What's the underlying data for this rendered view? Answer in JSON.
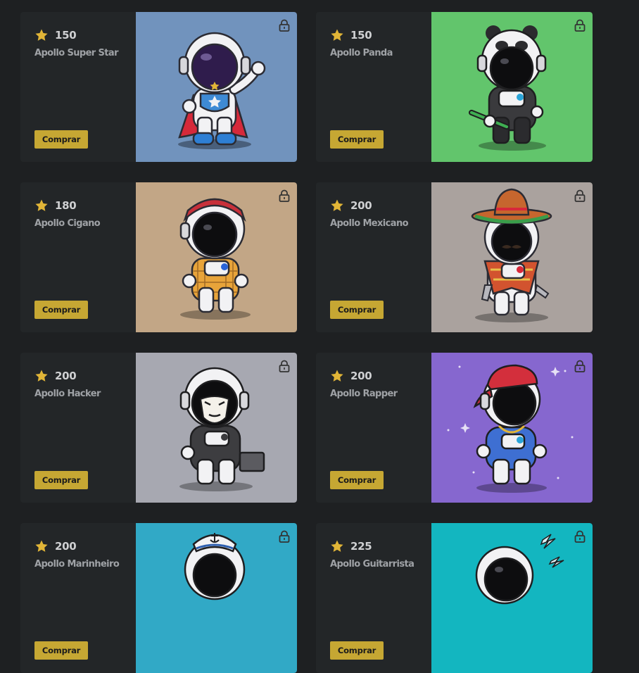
{
  "colors": {
    "page_bg": "#1e2022",
    "card_bg": "#232628",
    "star": "#e1b537",
    "buy_button": "#c6a733"
  },
  "icons": {
    "rating": "star-icon",
    "lock": "lock-icon"
  },
  "cards": [
    {
      "price": "150",
      "name": "Apollo Super Star",
      "button": "Comprar",
      "art_bg": "#7193bd"
    },
    {
      "price": "150",
      "name": "Apollo Panda",
      "button": "Comprar",
      "art_bg": "#62c56c"
    },
    {
      "price": "180",
      "name": "Apollo Cigano",
      "button": "Comprar",
      "art_bg": "#c2a686"
    },
    {
      "price": "200",
      "name": "Apollo Mexicano",
      "button": "Comprar",
      "art_bg": "#aaa29e"
    },
    {
      "price": "200",
      "name": "Apollo Hacker",
      "button": "Comprar",
      "art_bg": "#a7a8b1"
    },
    {
      "price": "200",
      "name": "Apollo Rapper",
      "button": "Comprar",
      "art_bg": "#8667cf"
    },
    {
      "price": "200",
      "name": "Apollo Marinheiro",
      "button": "Comprar",
      "art_bg": "#31a9c6"
    },
    {
      "price": "225",
      "name": "Apollo Guitarrista",
      "button": "Comprar",
      "art_bg": "#13b6c0"
    }
  ]
}
